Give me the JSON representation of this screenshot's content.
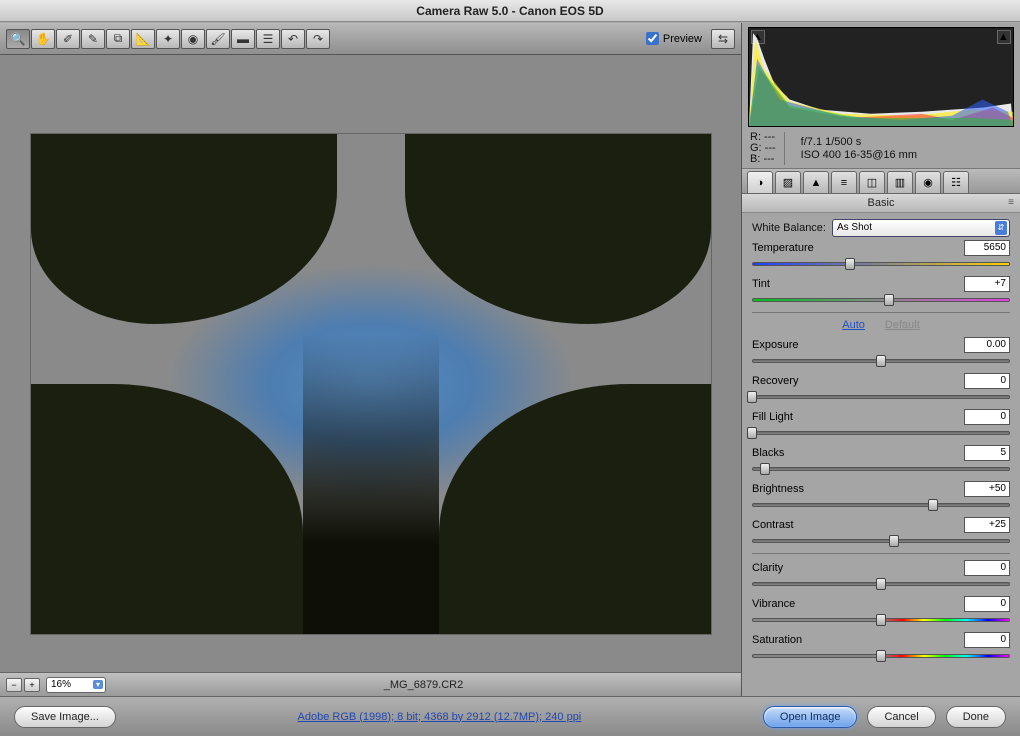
{
  "window": {
    "title": "Camera Raw 5.0  -  Canon EOS 5D"
  },
  "toolbar": {
    "preview_label": "Preview",
    "preview_checked": true
  },
  "status": {
    "zoom": "16%",
    "filename": "_MG_6879.CR2"
  },
  "meta": {
    "r": "R:   ---",
    "g": "G:   ---",
    "b": "B:   ---",
    "aperture_shutter": "f/7.1    1/500 s",
    "iso_lens": "ISO 400    16-35@16 mm"
  },
  "panel": {
    "title": "Basic",
    "wb_label": "White Balance:",
    "wb_value": "As Shot",
    "auto": "Auto",
    "default": "Default",
    "sliders": {
      "temperature": {
        "label": "Temperature",
        "value": "5650",
        "pos": 38
      },
      "tint": {
        "label": "Tint",
        "value": "+7",
        "pos": 53
      },
      "exposure": {
        "label": "Exposure",
        "value": "0.00",
        "pos": 50
      },
      "recovery": {
        "label": "Recovery",
        "value": "0",
        "pos": 0
      },
      "filllight": {
        "label": "Fill Light",
        "value": "0",
        "pos": 0
      },
      "blacks": {
        "label": "Blacks",
        "value": "5",
        "pos": 5
      },
      "brightness": {
        "label": "Brightness",
        "value": "+50",
        "pos": 70
      },
      "contrast": {
        "label": "Contrast",
        "value": "+25",
        "pos": 55
      },
      "clarity": {
        "label": "Clarity",
        "value": "0",
        "pos": 50
      },
      "vibrance": {
        "label": "Vibrance",
        "value": "0",
        "pos": 50
      },
      "saturation": {
        "label": "Saturation",
        "value": "0",
        "pos": 50
      }
    }
  },
  "footer": {
    "save": "Save Image...",
    "info": "Adobe RGB (1998); 8 bit; 4368 by 2912 (12.7MP); 240 ppi",
    "open": "Open Image",
    "cancel": "Cancel",
    "done": "Done"
  }
}
